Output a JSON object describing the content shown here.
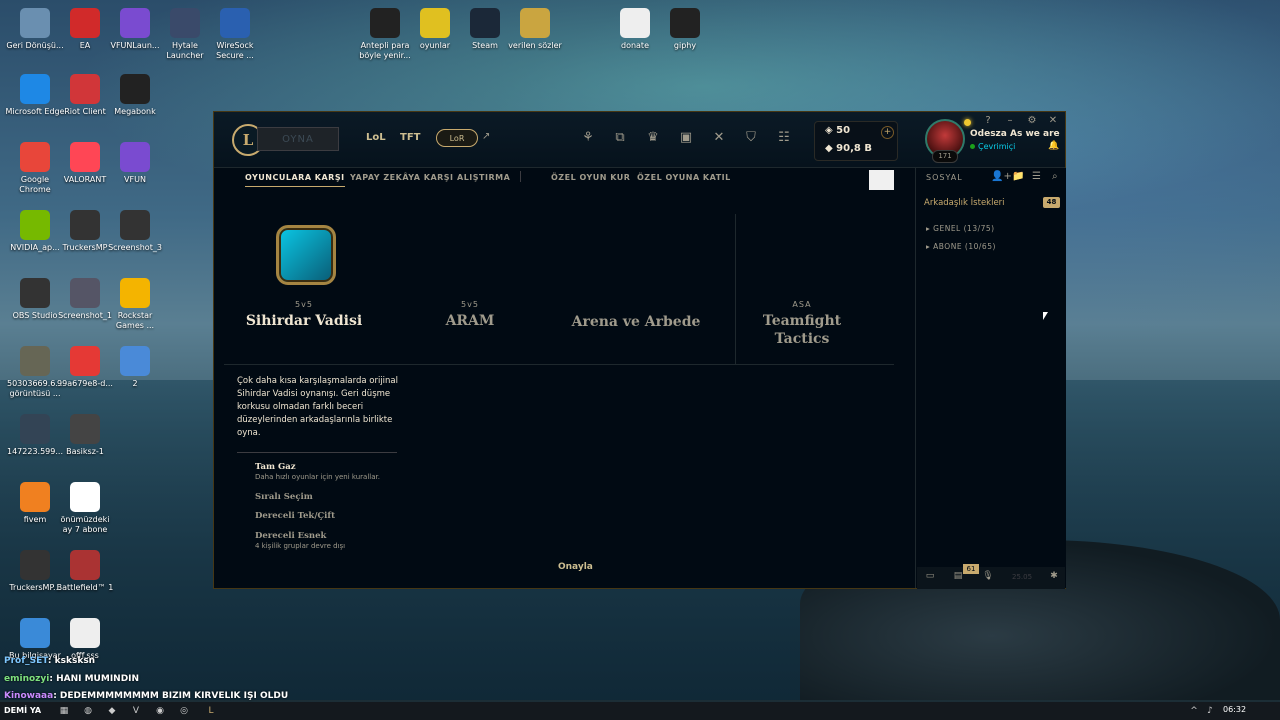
{
  "desktop_icons": [
    {
      "label": "Geri Dönüşü...",
      "icon": "recycle-bin-icon"
    },
    {
      "label": "EA",
      "icon": "ea-icon"
    },
    {
      "label": "VFUNLaun...",
      "icon": "vfun-icon"
    },
    {
      "label": "Hytale Launcher",
      "icon": "hytale-icon"
    },
    {
      "label": "WireSock Secure ...",
      "icon": "wiresock-icon"
    },
    {
      "label": "Antepli para böyle yenir...",
      "icon": "video-icon"
    },
    {
      "label": "oyunlar",
      "icon": "star-folder-icon"
    },
    {
      "label": "Steam",
      "icon": "steam-icon"
    },
    {
      "label": "verilen sözler",
      "icon": "folder-icon"
    },
    {
      "label": "donate",
      "icon": "play-icon"
    },
    {
      "label": "giphy",
      "icon": "image-icon"
    },
    {
      "label": "Microsoft Edge",
      "icon": "edge-icon"
    },
    {
      "label": "Riot Client",
      "icon": "riot-icon"
    },
    {
      "label": "Megabonk",
      "icon": "megabonk-icon"
    },
    {
      "label": "Google Chrome",
      "icon": "chrome-icon"
    },
    {
      "label": "VALORANT",
      "icon": "valorant-icon"
    },
    {
      "label": "VFUN",
      "icon": "vfun2-icon"
    },
    {
      "label": "NVIDIA_ap...",
      "icon": "nvidia-icon"
    },
    {
      "label": "TruckersMP",
      "icon": "truckersmp-icon"
    },
    {
      "label": "Screenshot_3",
      "icon": "screenshot-icon"
    },
    {
      "label": "OBS Studio",
      "icon": "obs-icon"
    },
    {
      "label": "Screenshot_1",
      "icon": "screenshot2-icon"
    },
    {
      "label": "Rockstar Games ...",
      "icon": "rockstar-icon"
    },
    {
      "label": "50303669.6... görüntüsü ...",
      "icon": "image2-icon"
    },
    {
      "label": "99a679e8-d...",
      "icon": "pdf-icon"
    },
    {
      "label": "2",
      "icon": "document-icon"
    },
    {
      "label": "147223.599...",
      "icon": "file-icon"
    },
    {
      "label": "Basiksz-1",
      "icon": "basiksz-icon"
    },
    {
      "label": "fivem",
      "icon": "fivem-icon"
    },
    {
      "label": "önümüzdeki ay 7 abone",
      "icon": "text-file-icon"
    },
    {
      "label": "TruckersMP...",
      "icon": "truckersmp2-icon"
    },
    {
      "label": "Battlefield™ 1",
      "icon": "battlefield-icon"
    },
    {
      "label": "Bu bilgisayar",
      "icon": "computer-icon"
    },
    {
      "label": "offf.sss",
      "icon": "video2-icon"
    }
  ],
  "client": {
    "play_label": "OYNA",
    "games": {
      "lol": "LoL",
      "tft": "TFT",
      "lor": "LoR"
    },
    "currency": {
      "rp": "50",
      "be": "90,8 B"
    },
    "summoner": {
      "name": "Odesza As we are",
      "status": "Çevrimiçi",
      "level": "171"
    },
    "tabs": [
      "OYUNCULARA KARŞI",
      "YAPAY ZEKÂYA KARŞI",
      "ALIŞTIRMA",
      "ÖZEL OYUN KUR",
      "ÖZEL OYUNA KATIL"
    ],
    "modes": [
      {
        "sub": "5v5",
        "name": "Sihirdar Vadisi"
      },
      {
        "sub": "5v5",
        "name": "ARAM"
      },
      {
        "sub": "",
        "name": "Arena ve Arbede"
      },
      {
        "sub": "ASA",
        "name": "Teamfight Tactics"
      }
    ],
    "description": "Çok daha kısa karşılaşmalarda orijinal Sihirdar Vadisi oynanışı. Geri düşme korkusu olmadan farklı beceri düzeylerinden arkadaşlarınla birlikte oyna.",
    "queues": [
      {
        "name": "Tam Gaz",
        "sub": "Daha hızlı oyunlar için yeni kurallar."
      },
      {
        "name": "Sıralı Seçim",
        "sub": ""
      },
      {
        "name": "Dereceli Tek/Çift",
        "sub": ""
      },
      {
        "name": "Dereceli Esnek",
        "sub": "4 kişilik gruplar devre dışı"
      }
    ],
    "confirm_label": "Onayla",
    "social": {
      "title": "SOSYAL",
      "friend_requests": "Arkadaşlık İstekleri",
      "friend_requests_count": "48",
      "groups": [
        "GENEL (13/75)",
        "ABONE (10/65)"
      ]
    },
    "bottom": {
      "notif_count": "61",
      "version": "25.05"
    }
  },
  "chat": [
    {
      "user": "Prof_SET",
      "text": ": ksksksn"
    },
    {
      "user": "eminozyi",
      "text": ": HANI MUMINDIN"
    },
    {
      "user": "Kinowaaa",
      "text": ": DEDEMMMMMMMM BIZIM KIRVELIK IŞI OLDU"
    }
  ],
  "taskbar": {
    "left_text": "DEMİ YA",
    "time": "06:32"
  }
}
